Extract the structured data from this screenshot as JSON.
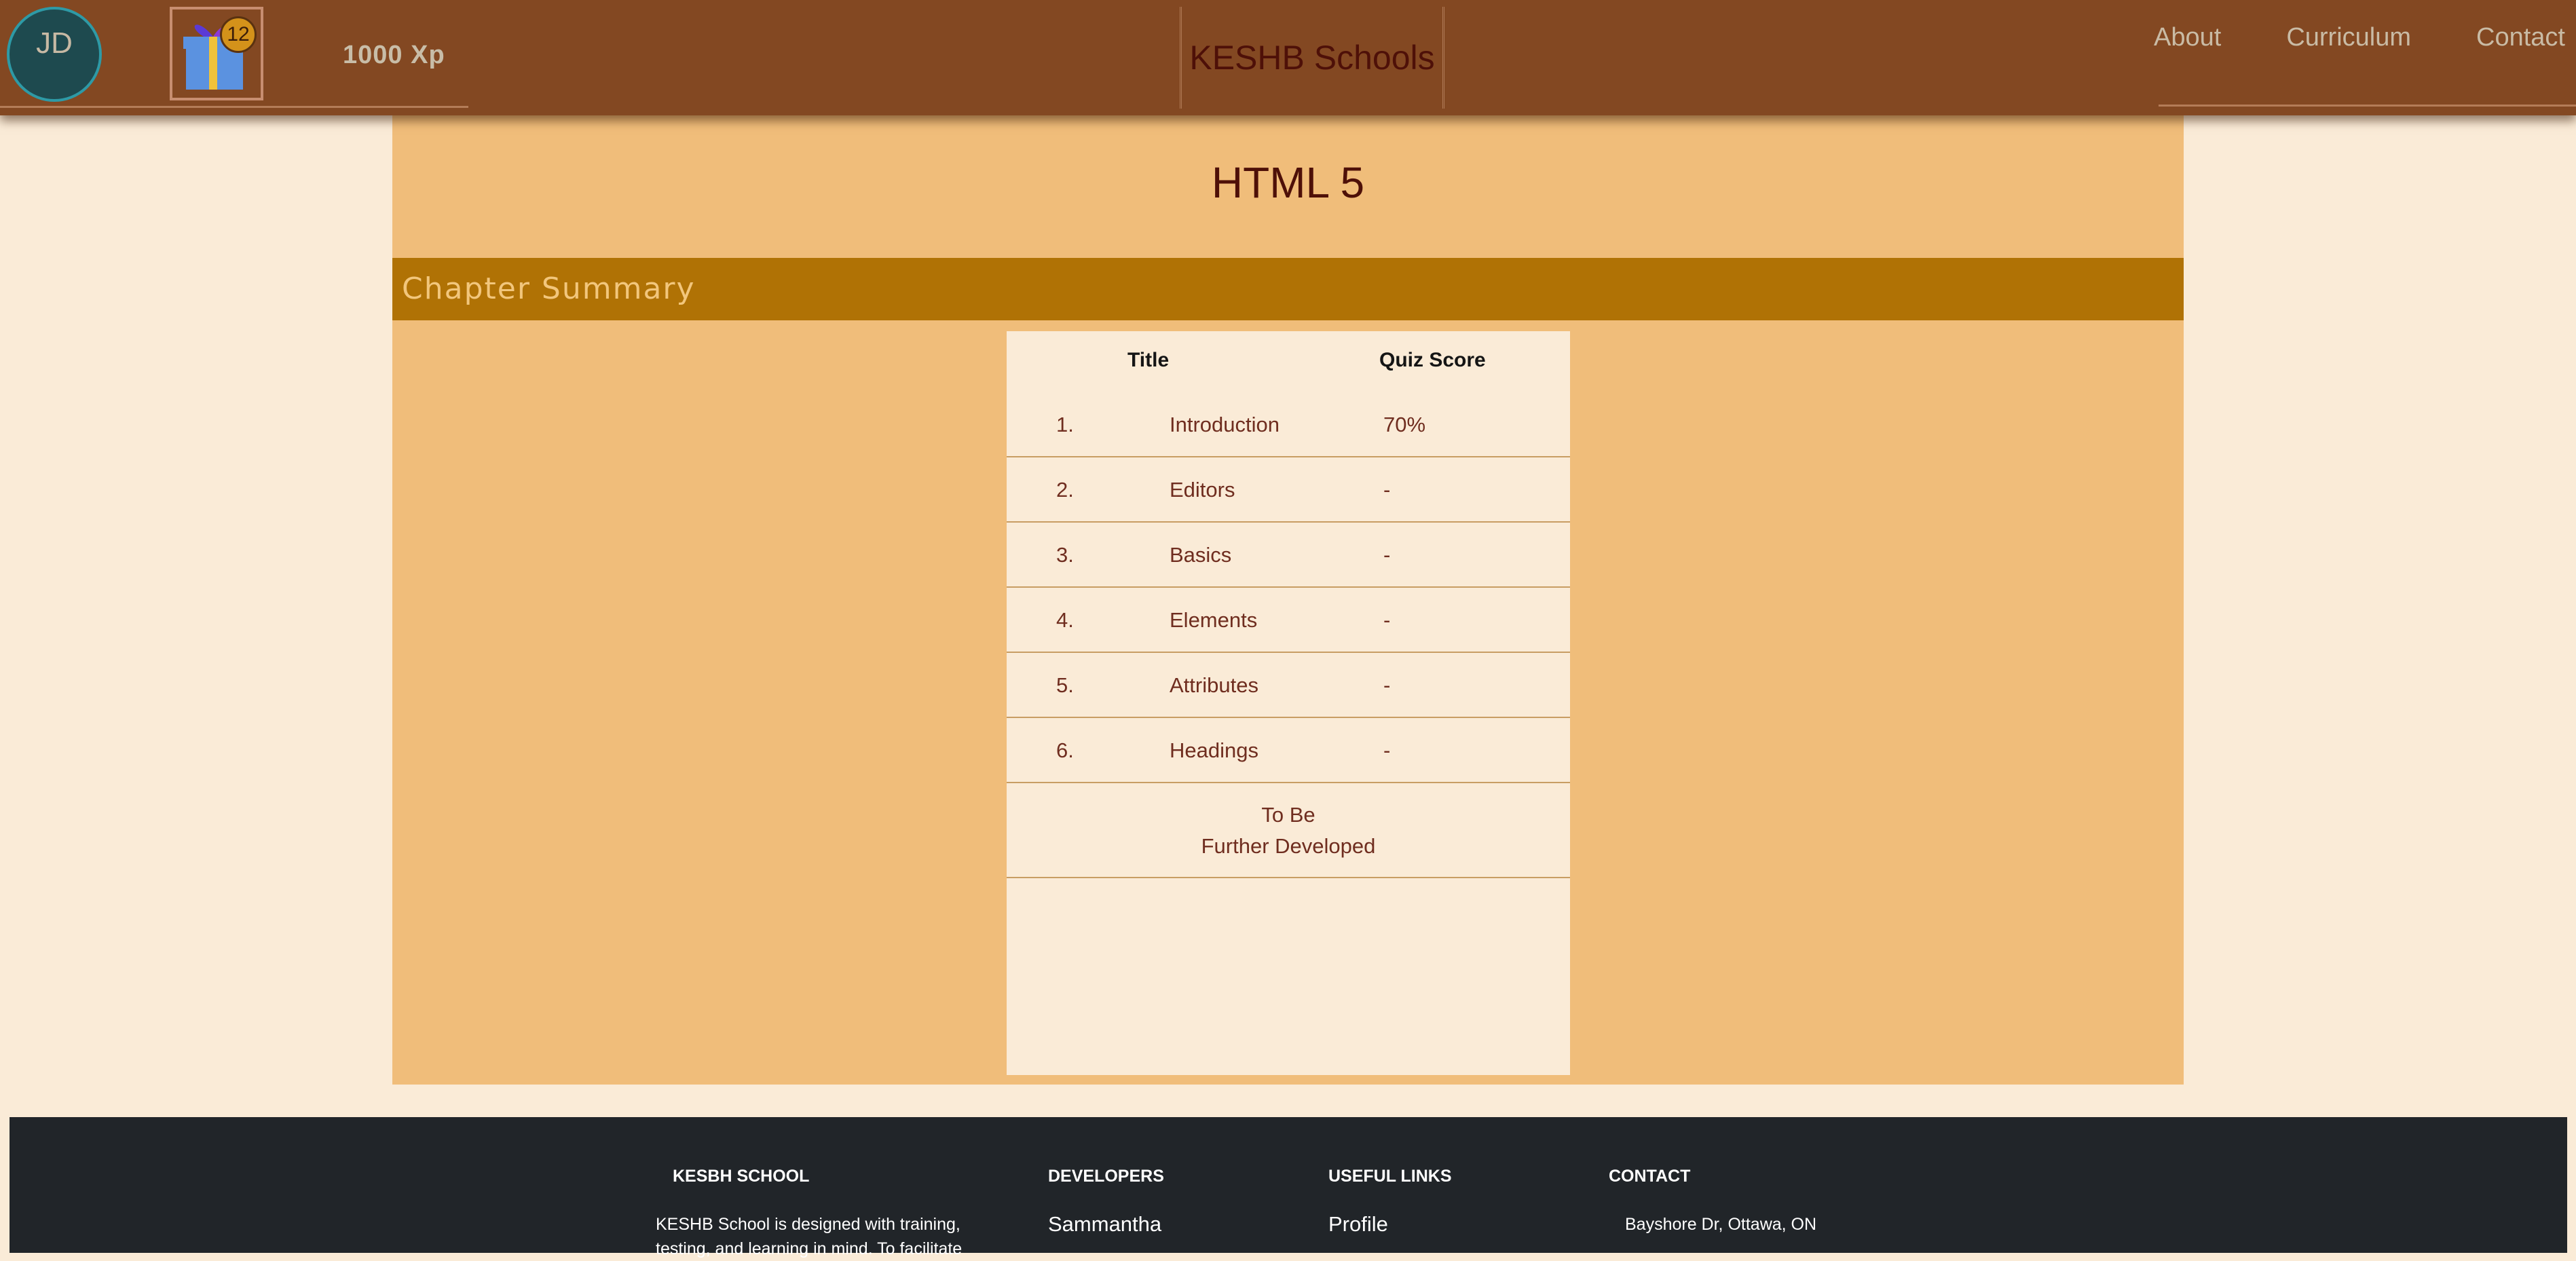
{
  "header": {
    "avatar_initials": "JD",
    "gift_count": "12",
    "xp": "1000 Xp",
    "brand": "KESHB Schools",
    "nav": [
      "About",
      "Curriculum",
      "Contact"
    ]
  },
  "main": {
    "title": "HTML 5",
    "section_title": "Chapter Summary",
    "table": {
      "headers": {
        "title": "Title",
        "score": "Quiz Score"
      },
      "rows": [
        {
          "num": "1.",
          "title": "Introduction",
          "score": "70%"
        },
        {
          "num": "2.",
          "title": "Editors",
          "score": "-"
        },
        {
          "num": "3.",
          "title": "Basics",
          "score": "-"
        },
        {
          "num": "4.",
          "title": "Elements",
          "score": "-"
        },
        {
          "num": "5.",
          "title": "Attributes",
          "score": "-"
        },
        {
          "num": "6.",
          "title": "Headings",
          "score": "-"
        }
      ],
      "footer_line1": "To Be",
      "footer_line2": "Further Developed"
    }
  },
  "footer": {
    "school": {
      "heading": "KESBH SCHOOL",
      "text_line1": "KESHB School is designed with training,",
      "text_line2": "testing, and learning in mind. To facilitate"
    },
    "developers": {
      "heading": "DEVELOPERS",
      "first": "Sammantha"
    },
    "links": {
      "heading": "USEFUL LINKS",
      "first": "Profile"
    },
    "contact": {
      "heading": "CONTACT",
      "address": "Bayshore Dr, Ottawa, ON"
    }
  },
  "colors": {
    "header_bg": "#834822",
    "page_bg": "#faebd7",
    "content_bg": "#f0bd7a",
    "section_bar": "#b07205",
    "title_text": "#4e1008",
    "footer_bg": "#212529"
  },
  "icons": [
    "gift-icon"
  ]
}
